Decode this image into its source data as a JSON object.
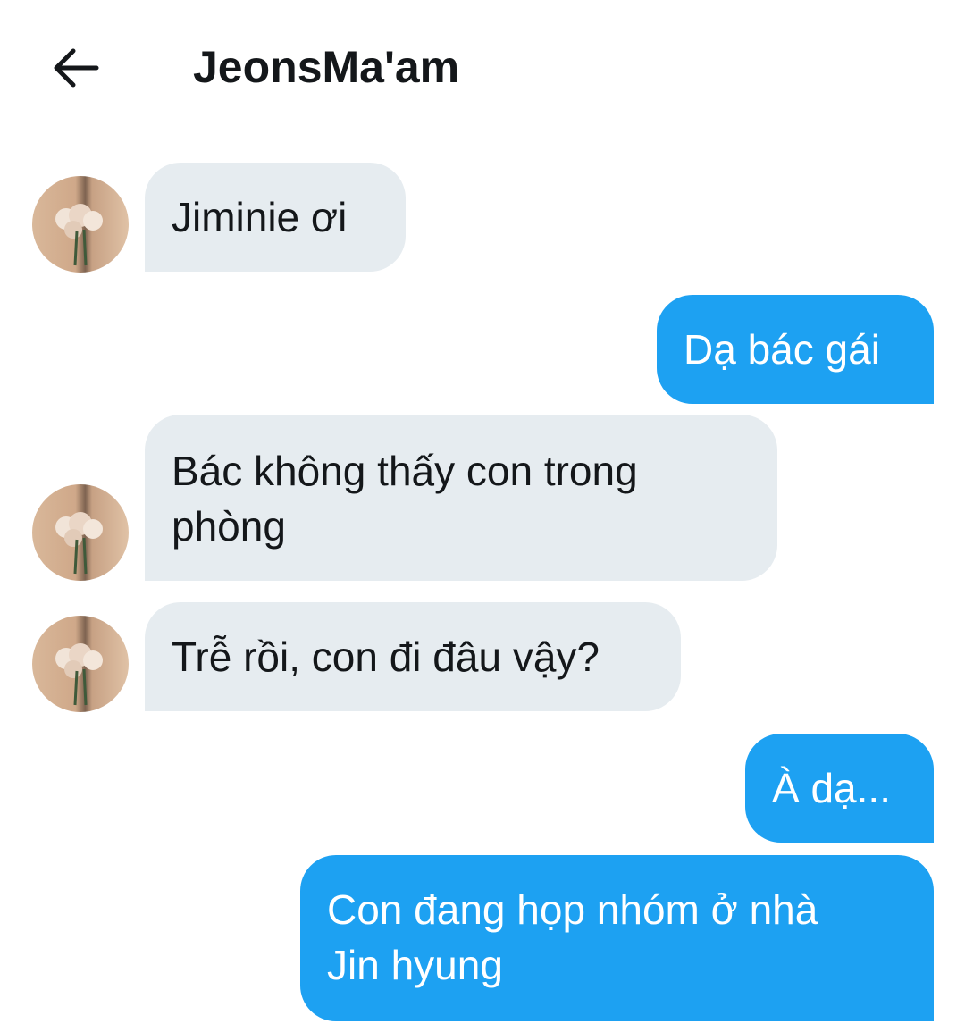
{
  "header": {
    "title": "JeonsMa'am",
    "back_icon": "arrow-left-icon"
  },
  "colors": {
    "incoming_bubble": "#e6ecf0",
    "outgoing_bubble": "#1da1f2",
    "text_dark": "#14171a"
  },
  "messages": [
    {
      "side": "incoming",
      "lines": [
        "Jiminie ơi"
      ]
    },
    {
      "side": "outgoing",
      "lines": [
        "Dạ bác gái"
      ]
    },
    {
      "side": "incoming",
      "lines": [
        "Bác không thấy con trong",
        "phòng"
      ]
    },
    {
      "side": "incoming",
      "lines": [
        "Trễ rồi, con đi đâu vậy?"
      ]
    },
    {
      "side": "outgoing",
      "lines": [
        "À dạ..."
      ]
    },
    {
      "side": "outgoing",
      "lines": [
        "Con đang họp nhóm ở nhà",
        "Jin hyung"
      ]
    }
  ]
}
